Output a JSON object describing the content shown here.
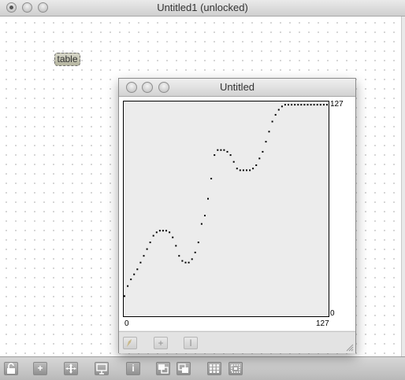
{
  "patcher": {
    "title": "Untitled1 (unlocked)",
    "object_label": "table"
  },
  "table_window": {
    "title": "Untitled",
    "y_max_label": "127",
    "y_min_label": "0",
    "x_min_label": "0",
    "x_max_label": "127",
    "footer_icons": [
      "pencil-icon",
      "plus-icon",
      "text-cursor-icon"
    ]
  },
  "toolbar": {
    "icons": [
      "lock-icon",
      "add-object-icon",
      "move-icon",
      "presentation-icon",
      "inspector-icon",
      "new-view-icon",
      "layer-icon",
      "grid-icon",
      "snap-icon"
    ]
  },
  "chart_data": {
    "type": "scatter",
    "xlabel": "",
    "ylabel": "",
    "xlim": [
      0,
      127
    ],
    "ylim": [
      0,
      127
    ],
    "x": [
      0,
      2,
      4,
      6,
      8,
      10,
      12,
      14,
      16,
      18,
      20,
      22,
      24,
      26,
      28,
      30,
      32,
      34,
      36,
      38,
      40,
      42,
      44,
      46,
      48,
      50,
      52,
      54,
      56,
      58,
      60,
      62,
      64,
      66,
      68,
      70,
      72,
      74,
      76,
      78,
      80,
      82,
      84,
      86,
      88,
      90,
      92,
      94,
      96,
      98,
      100,
      102,
      104,
      106,
      108,
      110,
      112,
      114,
      116,
      118,
      120,
      122,
      124,
      126
    ],
    "y": [
      12,
      18,
      22,
      25,
      28,
      32,
      36,
      40,
      44,
      48,
      50,
      51,
      51,
      51,
      50,
      47,
      42,
      36,
      33,
      32,
      32,
      34,
      38,
      44,
      55,
      60,
      70,
      82,
      96,
      99,
      99,
      99,
      98,
      96,
      92,
      88,
      87,
      87,
      87,
      87,
      88,
      90,
      94,
      98,
      104,
      110,
      116,
      120,
      123,
      125,
      126,
      126,
      126,
      126,
      126,
      126,
      126,
      126,
      126,
      126,
      126,
      126,
      126,
      126
    ]
  }
}
